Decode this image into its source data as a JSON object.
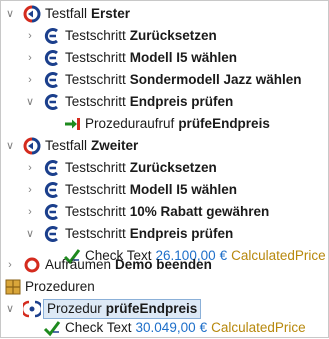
{
  "tree": {
    "testcase1": {
      "kind": "Testfall",
      "name": "Erster"
    },
    "steps1": [
      {
        "kind": "Testschritt",
        "name": "Zurücksetzen"
      },
      {
        "kind": "Testschritt",
        "name": "Modell I5 wählen"
      },
      {
        "kind": "Testschritt",
        "name": "Sondermodell Jazz wählen"
      },
      {
        "kind": "Testschritt",
        "name": "Endpreis prüfen"
      }
    ],
    "call1": {
      "kind": "Prozeduraufruf",
      "name": "prüfeEndpreis"
    },
    "testcase2": {
      "kind": "Testfall",
      "name": "Zweiter"
    },
    "steps2": [
      {
        "kind": "Testschritt",
        "name": "Zurücksetzen"
      },
      {
        "kind": "Testschritt",
        "name": "Modell I5 wählen"
      },
      {
        "kind": "Testschritt",
        "name": "10% Rabatt gewähren"
      },
      {
        "kind": "Testschritt",
        "name": "Endpreis prüfen"
      }
    ],
    "check1": {
      "kind": "Check Text",
      "value": "26.100,00",
      "currency": "€",
      "component": "CalculatedPrice"
    },
    "cleanup": {
      "kind": "Aufräumen",
      "name": "Demo beenden"
    },
    "procedures": {
      "label": "Prozeduren"
    },
    "procedure": {
      "kind": "Prozedur",
      "name": "prüfeEndpreis"
    },
    "check2": {
      "kind": "Check Text",
      "value": "30.049,00",
      "currency": "€",
      "component": "CalculatedPrice"
    }
  },
  "colors": {
    "setup_red": "#d42b1e",
    "step_blue": "#1b3f8c",
    "check_green": "#1e8a1e",
    "selection": "#dde9f6"
  }
}
